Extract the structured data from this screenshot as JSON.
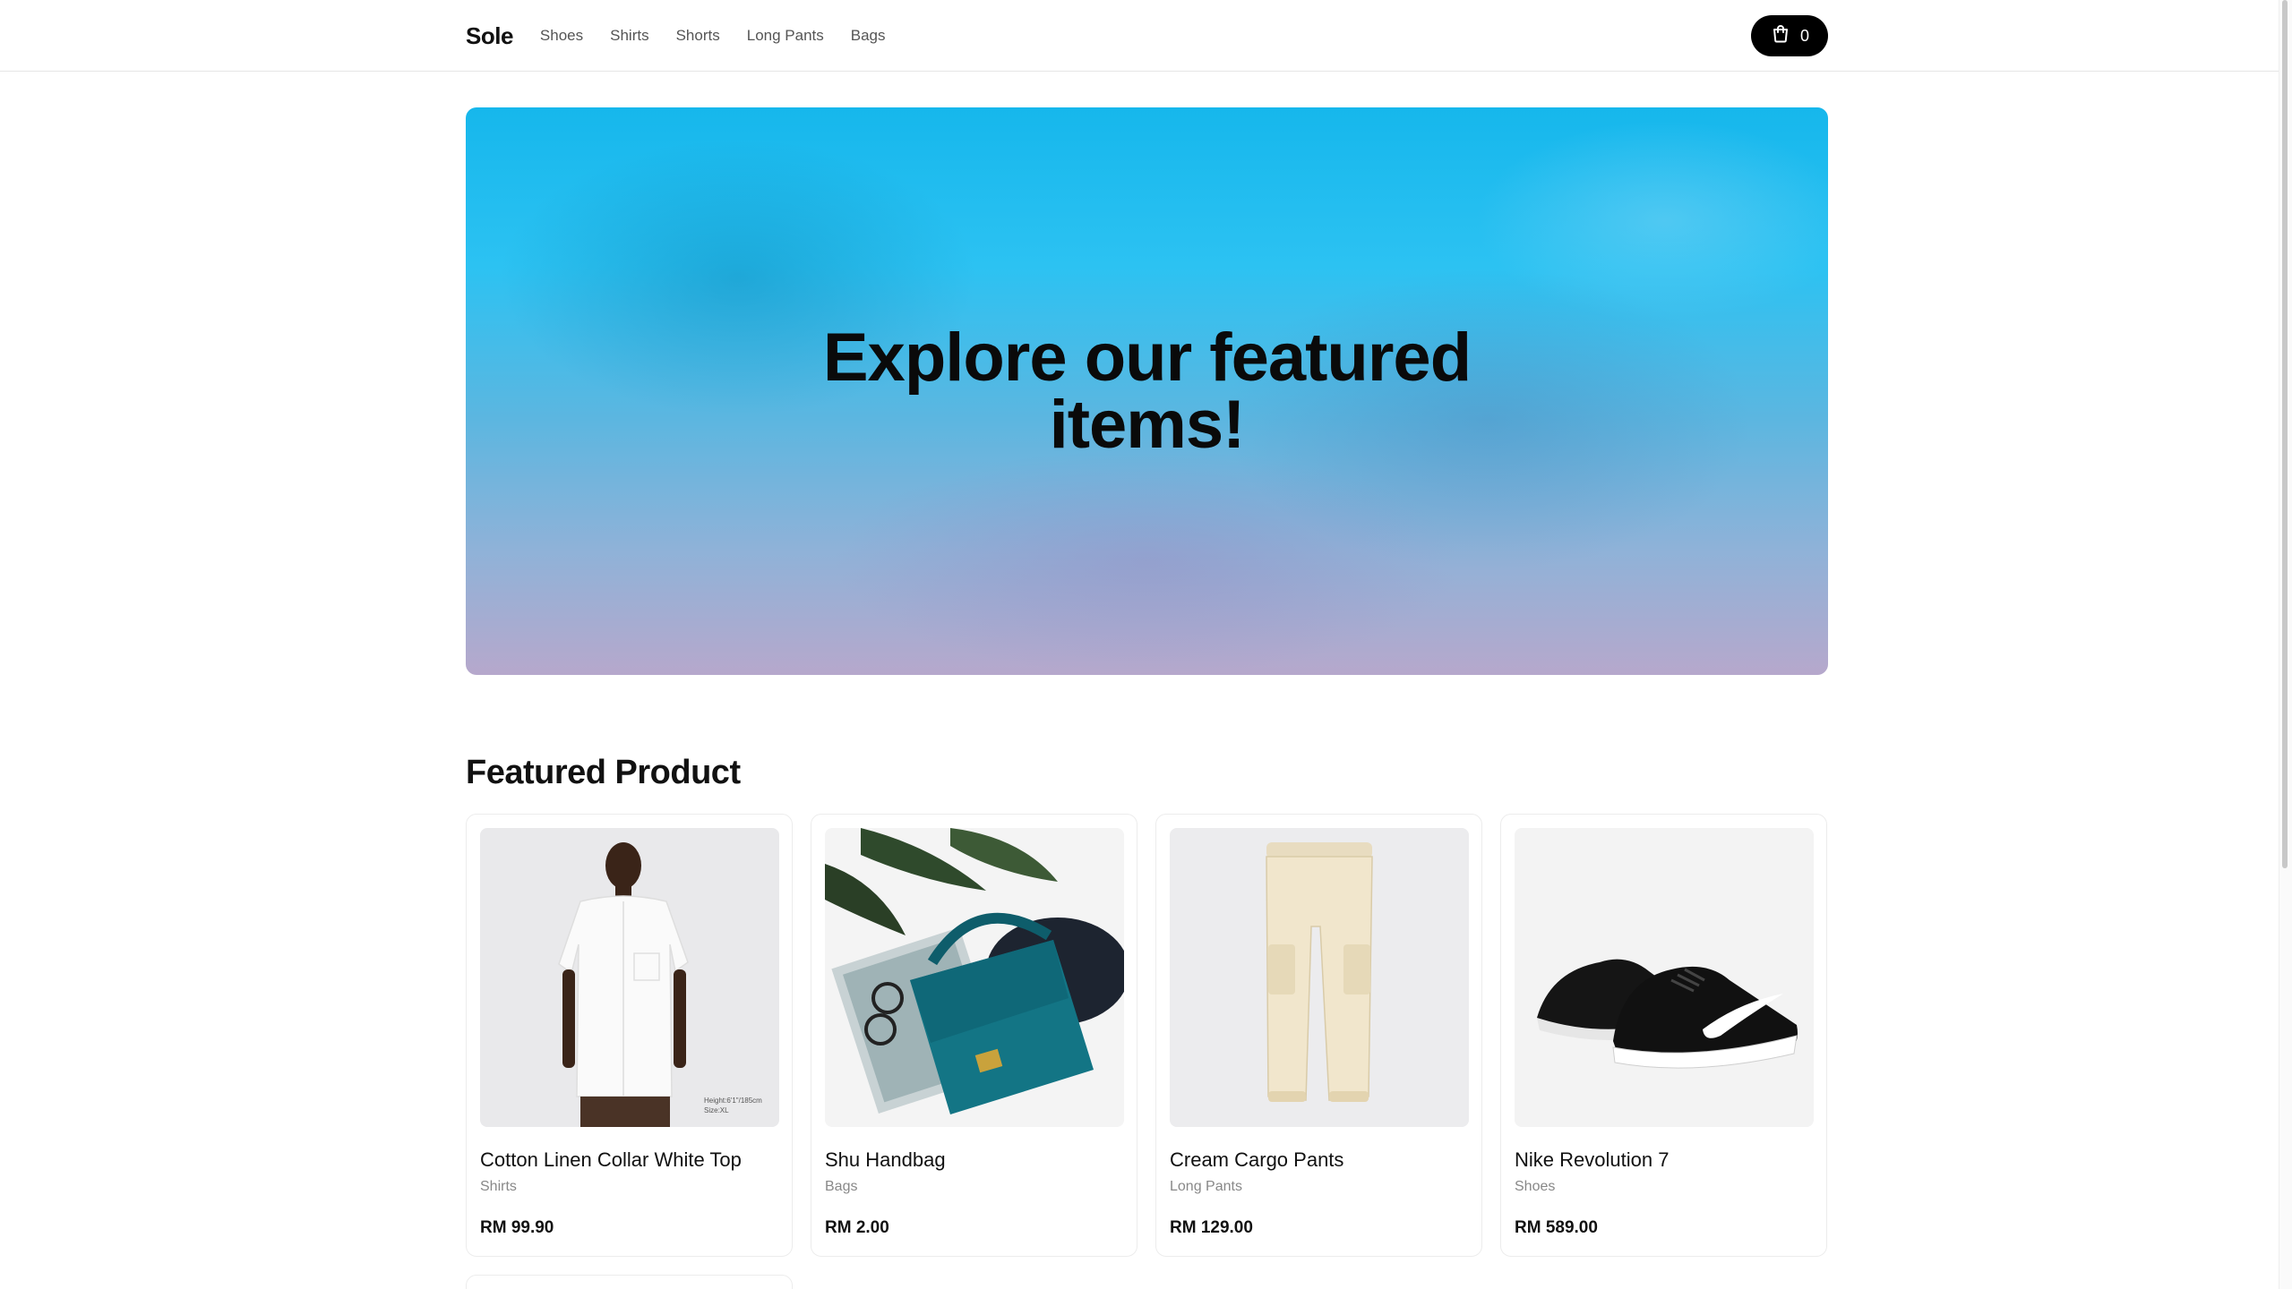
{
  "header": {
    "logo": "Sole",
    "nav": [
      "Shoes",
      "Shirts",
      "Shorts",
      "Long Pants",
      "Bags"
    ],
    "cart_count": "0"
  },
  "hero": {
    "title": "Explore our featured items!"
  },
  "featured": {
    "title": "Featured Product",
    "products": [
      {
        "name": "Cotton Linen Collar White Top",
        "category": "Shirts",
        "price": "RM 99.90",
        "image_caption": "Height:6'1\"/185cm Size:XL"
      },
      {
        "name": "Shu Handbag",
        "category": "Bags",
        "price": "RM 2.00"
      },
      {
        "name": "Cream Cargo Pants",
        "category": "Long Pants",
        "price": "RM 129.00"
      },
      {
        "name": "Nike Revolution 7",
        "category": "Shoes",
        "price": "RM 589.00"
      }
    ]
  },
  "colors": {
    "accent": "#000000",
    "hero_top": "#16b7ec",
    "hero_bottom": "#b6a8cc"
  },
  "icons": {
    "cart": "shopping-bag-icon"
  }
}
